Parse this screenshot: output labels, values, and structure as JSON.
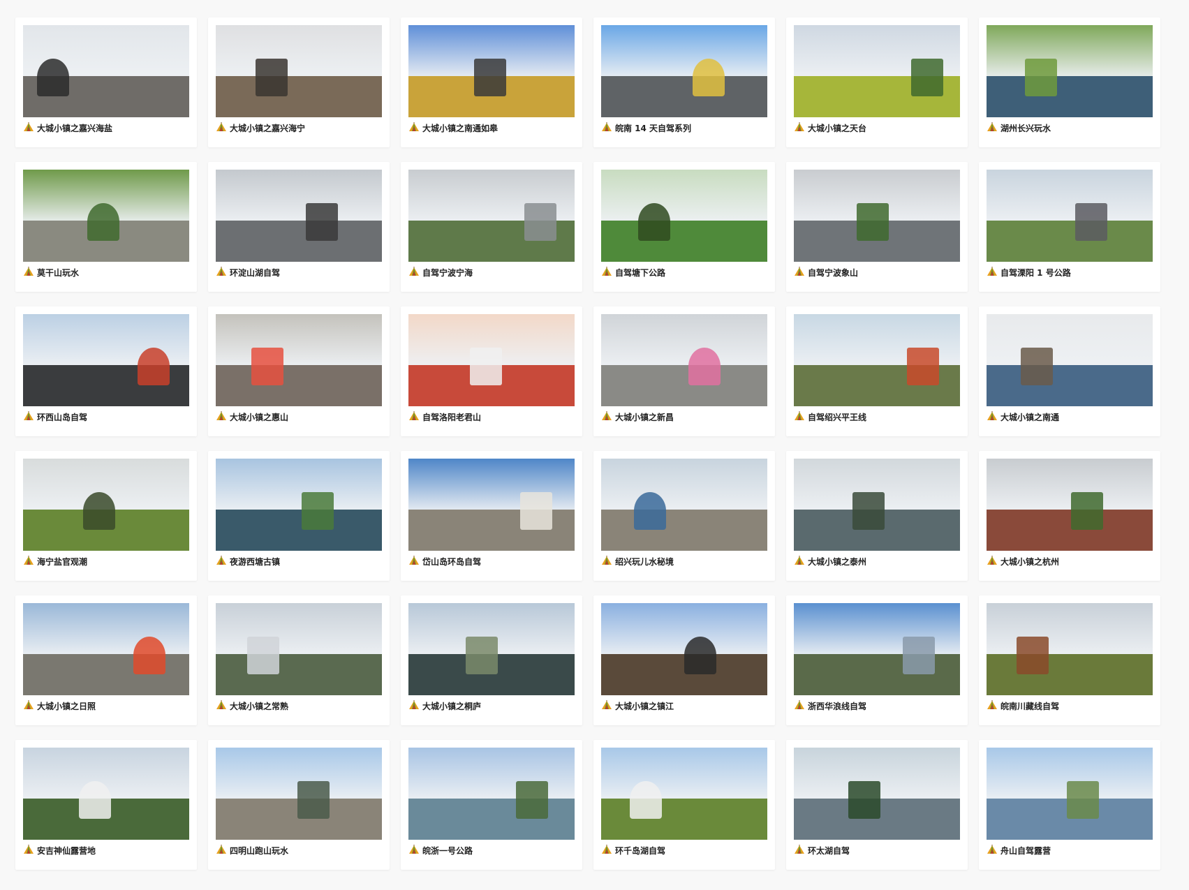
{
  "caption_icon": "campsite-tent-icon",
  "colors": {
    "page_background": "#f8f8f8",
    "card_background": "#ffffff",
    "title_text": "#222222"
  },
  "cards": [
    {
      "title": "大城小镇之嘉兴海盐",
      "thumb": {
        "sky": "#e2e6ea",
        "land": "#6f6c68",
        "accent": "#2b2b2b"
      }
    },
    {
      "title": "大城小镇之嘉兴海宁",
      "thumb": {
        "sky": "#dfe0e2",
        "land": "#7a6a58",
        "accent": "#3a3530"
      }
    },
    {
      "title": "大城小镇之南通如皋",
      "thumb": {
        "sky": "#5f8fd8",
        "land": "#c9a33a",
        "accent": "#3a3a3a"
      }
    },
    {
      "title": "皖南 14 天自驾系列",
      "thumb": {
        "sky": "#6aa7e6",
        "land": "#5f6366",
        "accent": "#e0c040"
      }
    },
    {
      "title": "大城小镇之天台",
      "thumb": {
        "sky": "#cfd8e2",
        "land": "#a6b63a",
        "accent": "#3f6a2e"
      }
    },
    {
      "title": "湖州长兴玩水",
      "thumb": {
        "sky": "#7fa85a",
        "land": "#3e5f78",
        "accent": "#6e9a3c"
      }
    },
    {
      "title": "莫干山玩水",
      "thumb": {
        "sky": "#6f9a4a",
        "land": "#8a8a80",
        "accent": "#3f6a2e"
      }
    },
    {
      "title": "环淀山湖自驾",
      "thumb": {
        "sky": "#c4c9ce",
        "land": "#6c6f72",
        "accent": "#3a3a3a"
      }
    },
    {
      "title": "自驾宁波宁海",
      "thumb": {
        "sky": "#c8ccd0",
        "land": "#5f7a4a",
        "accent": "#8a8e90"
      }
    },
    {
      "title": "自驾塘下公路",
      "thumb": {
        "sky": "#c8dcc0",
        "land": "#4f8a3a",
        "accent": "#2f4a20"
      }
    },
    {
      "title": "自驾宁波象山",
      "thumb": {
        "sky": "#c9ccd0",
        "land": "#6f7478",
        "accent": "#3f6a2e"
      }
    },
    {
      "title": "自驾溧阳 1 号公路",
      "thumb": {
        "sky": "#c9d4de",
        "land": "#6a8a4a",
        "accent": "#5a5a60"
      }
    },
    {
      "title": "环西山岛自驾",
      "thumb": {
        "sky": "#bcd0e4",
        "land": "#3a3c3e",
        "accent": "#c8402a"
      }
    },
    {
      "title": "大城小镇之惠山",
      "thumb": {
        "sky": "#c4c2bc",
        "land": "#7a7068",
        "accent": "#e65040"
      }
    },
    {
      "title": "自驾洛阳老君山",
      "thumb": {
        "sky": "#f2d8c8",
        "land": "#c84a3a",
        "accent": "#f0f0f0"
      }
    },
    {
      "title": "大城小镇之新昌",
      "thumb": {
        "sky": "#d0d4d8",
        "land": "#8a8a86",
        "accent": "#e070a0"
      }
    },
    {
      "title": "自驾绍兴平王线",
      "thumb": {
        "sky": "#c8d8e4",
        "land": "#6a7a4a",
        "accent": "#c84a2a"
      }
    },
    {
      "title": "大城小镇之南通",
      "thumb": {
        "sky": "#e8eaec",
        "land": "#4a6a8a",
        "accent": "#6a5a4a"
      }
    },
    {
      "title": "海宁盐官观潮",
      "thumb": {
        "sky": "#d8dcdc",
        "land": "#6a8a3a",
        "accent": "#3a4a2a"
      }
    },
    {
      "title": "夜游西塘古镇",
      "thumb": {
        "sky": "#a8c4e0",
        "land": "#3a5a6a",
        "accent": "#4a7a3a"
      }
    },
    {
      "title": "岱山岛环岛自驾",
      "thumb": {
        "sky": "#4f86c8",
        "land": "#8a8478",
        "accent": "#e8e4dc"
      }
    },
    {
      "title": "绍兴玩儿水秘境",
      "thumb": {
        "sky": "#c8d4de",
        "land": "#8a8478",
        "accent": "#3a6a9a"
      }
    },
    {
      "title": "大城小镇之泰州",
      "thumb": {
        "sky": "#d2d8dc",
        "land": "#5a6a6e",
        "accent": "#3a4a3a"
      }
    },
    {
      "title": "大城小镇之杭州",
      "thumb": {
        "sky": "#c8ccd0",
        "land": "#8a4a3a",
        "accent": "#3f6a2e"
      }
    },
    {
      "title": "大城小镇之日照",
      "thumb": {
        "sky": "#9ab8d8",
        "land": "#7a7870",
        "accent": "#e04a2a"
      }
    },
    {
      "title": "大城小镇之常熟",
      "thumb": {
        "sky": "#c8d0d8",
        "land": "#5a6a50",
        "accent": "#d0d4d8"
      }
    },
    {
      "title": "大城小镇之桐庐",
      "thumb": {
        "sky": "#b8c8d8",
        "land": "#3a4a4a",
        "accent": "#7a8a6a"
      }
    },
    {
      "title": "大城小镇之镇江",
      "thumb": {
        "sky": "#8ab0e0",
        "land": "#5a4a3a",
        "accent": "#2a2a2a"
      }
    },
    {
      "title": "浙西华浪线自驾",
      "thumb": {
        "sky": "#5a90d0",
        "land": "#5a6a4a",
        "accent": "#8a9aaa"
      }
    },
    {
      "title": "皖南川藏线自驾",
      "thumb": {
        "sky": "#c8d0d8",
        "land": "#6a7a3a",
        "accent": "#8a4a2a"
      }
    },
    {
      "title": "安吉神仙露营地",
      "thumb": {
        "sky": "#c8d4e0",
        "land": "#4a6a3a",
        "accent": "#f0f0f0"
      }
    },
    {
      "title": "四明山跑山玩水",
      "thumb": {
        "sky": "#a8c8e8",
        "land": "#8a8478",
        "accent": "#4a5a4a"
      }
    },
    {
      "title": "皖浙一号公路",
      "thumb": {
        "sky": "#a8c4e4",
        "land": "#6a8a9a",
        "accent": "#4a6a3a"
      }
    },
    {
      "title": "环千岛湖自驾",
      "thumb": {
        "sky": "#a8c8e8",
        "land": "#6a8a3a",
        "accent": "#f0f0f0"
      }
    },
    {
      "title": "环太湖自驾",
      "thumb": {
        "sky": "#c8d4dc",
        "land": "#6a7a84",
        "accent": "#2a4a2a"
      }
    },
    {
      "title": "舟山自驾露营",
      "thumb": {
        "sky": "#a8c8e8",
        "land": "#6a8aa8",
        "accent": "#6a8a4a"
      }
    }
  ]
}
